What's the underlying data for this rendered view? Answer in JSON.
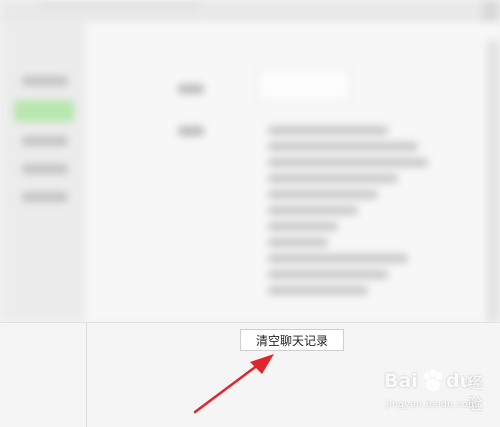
{
  "dialog": {
    "clear_button_label": "清空聊天记录"
  },
  "watermark": {
    "brand_left": "Bai",
    "brand_right": "du",
    "brand_suffix": "经验",
    "url": "jingyan.baidu.com"
  },
  "colors": {
    "arrow": "#e0262b",
    "sidebar_active": "#b9e6b0"
  }
}
